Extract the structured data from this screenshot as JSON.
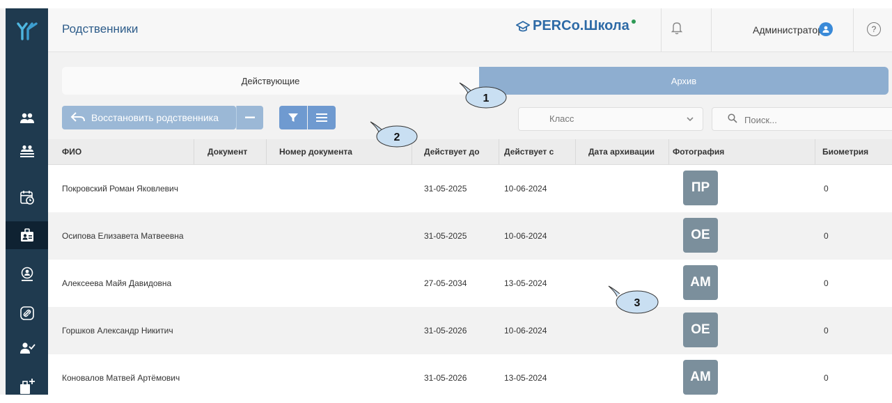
{
  "header": {
    "page_title": "Родственники",
    "brand": "PERCo.Школа",
    "user_name": "Администратор",
    "help": "?"
  },
  "tabs": [
    {
      "label": "Действующие",
      "active": true
    },
    {
      "label": "Архив",
      "active": false
    }
  ],
  "toolbar": {
    "restore_label": "Восстановить родственника"
  },
  "filters": {
    "class_placeholder": "Класс",
    "search_placeholder": "Поиск..."
  },
  "table": {
    "columns": [
      "ФИО",
      "Документ",
      "Номер документа",
      "Действует до",
      "Действует с",
      "Дата архивации",
      "Фотография",
      "Биометрия"
    ],
    "rows": [
      {
        "fio": "Покровский Роман Яковлевич",
        "doc": "",
        "doc_number": "",
        "valid_to": "31-05-2025",
        "valid_from": "10-06-2024",
        "archived": "",
        "photo": "ПР",
        "biometry": "0"
      },
      {
        "fio": "Осипова Елизавета Матвеевна",
        "doc": "",
        "doc_number": "",
        "valid_to": "31-05-2025",
        "valid_from": "10-06-2024",
        "archived": "",
        "photo": "ОЕ",
        "biometry": "0"
      },
      {
        "fio": "Алексеева Майя Давидовна",
        "doc": "",
        "doc_number": "",
        "valid_to": "27-05-2034",
        "valid_from": "13-05-2024",
        "archived": "",
        "photo": "АМ",
        "biometry": "0"
      },
      {
        "fio": "Горшков Александр Никитич",
        "doc": "",
        "doc_number": "",
        "valid_to": "31-05-2026",
        "valid_from": "10-06-2024",
        "archived": "",
        "photo": "ОЕ",
        "biometry": "0"
      },
      {
        "fio": "Коновалов Матвей Артёмович",
        "doc": "",
        "doc_number": "",
        "valid_to": "31-05-2026",
        "valid_from": "13-05-2024",
        "archived": "",
        "photo": "АМ",
        "biometry": "0"
      }
    ]
  },
  "callouts": [
    "1",
    "2",
    "3"
  ],
  "colors": {
    "sidebar": "#1f3a4f",
    "brand": "#2d6aa6",
    "archive_tab": "#8eaed0",
    "action_button": "#9bb8d6",
    "filter_button": "#6f9ad0",
    "photo_placeholder": "#7b8f9c"
  },
  "sidebar_icons": [
    "logo-icon",
    "users-icon",
    "group-users-icon",
    "calendar-clock-icon",
    "relatives-badge-icon",
    "user-location-icon",
    "link-icon",
    "user-check-icon",
    "add-building-icon"
  ]
}
